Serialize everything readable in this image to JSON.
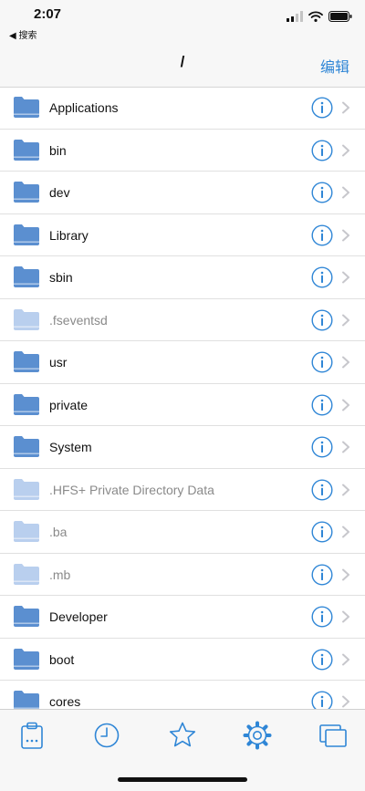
{
  "status": {
    "time": "2:07",
    "back_label": "◀ 搜索"
  },
  "nav": {
    "title": "/",
    "edit_label": "编辑"
  },
  "items": [
    {
      "name": "Applications",
      "hidden": false
    },
    {
      "name": "bin",
      "hidden": false
    },
    {
      "name": "dev",
      "hidden": false
    },
    {
      "name": "Library",
      "hidden": false
    },
    {
      "name": "sbin",
      "hidden": false
    },
    {
      "name": ".fseventsd",
      "hidden": true
    },
    {
      "name": "usr",
      "hidden": false
    },
    {
      "name": "private",
      "hidden": false
    },
    {
      "name": "System",
      "hidden": false
    },
    {
      "name": ".HFS+ Private Directory Data",
      "hidden": true
    },
    {
      "name": ".ba",
      "hidden": true
    },
    {
      "name": ".mb",
      "hidden": true
    },
    {
      "name": "Developer",
      "hidden": false
    },
    {
      "name": "boot",
      "hidden": false
    },
    {
      "name": "cores",
      "hidden": false
    }
  ],
  "tabs": [
    {
      "icon": "clipboard-icon"
    },
    {
      "icon": "clock-icon"
    },
    {
      "icon": "star-icon"
    },
    {
      "icon": "gear-icon"
    },
    {
      "icon": "windows-icon"
    }
  ],
  "colors": {
    "accent": "#2f86d6",
    "folder": "#5b8fd0",
    "folder_hidden": "#b9cfee",
    "chevron": "#c7c7cc"
  }
}
